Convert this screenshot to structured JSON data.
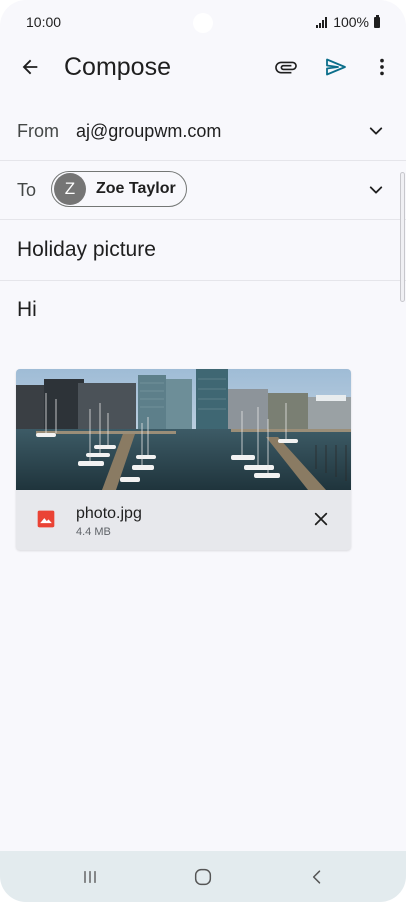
{
  "status_bar": {
    "time": "10:00",
    "battery": "100%"
  },
  "app_bar": {
    "title": "Compose",
    "icons": {
      "back": "arrow-left-icon",
      "attach": "paperclip-icon",
      "send": "send-icon",
      "more": "more-vertical-icon"
    }
  },
  "from": {
    "label": "From",
    "value": "aj@groupwm.com"
  },
  "to": {
    "label": "To",
    "recipient": {
      "initial": "Z",
      "name": "Zoe Taylor"
    }
  },
  "subject": "Holiday picture",
  "body": "Hi",
  "attachment": {
    "file_name": "photo.jpg",
    "file_size": "4.4 MB"
  },
  "colors": {
    "accent": "#0b6e8a",
    "file_icon": "#ea4335",
    "nav_bar": "#e3ebee"
  }
}
